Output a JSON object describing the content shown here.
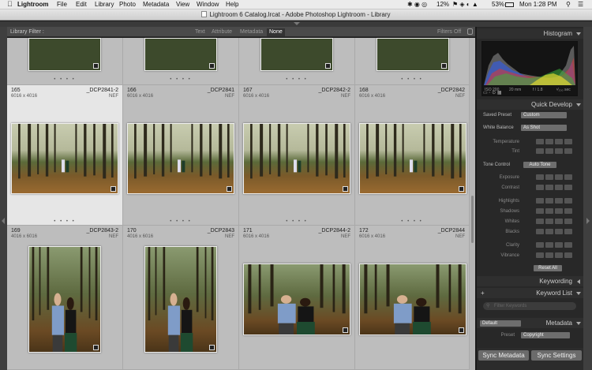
{
  "menubar": {
    "apple": "",
    "items": [
      "Lightroom",
      "File",
      "Edit",
      "Library",
      "Photo",
      "Metadata",
      "View",
      "Window",
      "Help"
    ],
    "status": {
      "pct_a": "12%",
      "battery": "53%",
      "clock": "Mon 1:28 PM"
    }
  },
  "window": {
    "title": "Lightroom 6 Catalog.lrcat - Adobe Photoshop Lightroom - Library"
  },
  "filterbar": {
    "label": "Library Filter :",
    "tabs": [
      "Text",
      "Attribute",
      "Metadata",
      "None"
    ],
    "active_tab": "None",
    "filters_off": "Filters Off"
  },
  "grid": {
    "dots": "• • • •",
    "cells": [
      {
        "num": "165",
        "dims": "6016 x 4016",
        "name": "_DCP2841-2",
        "type": "NEF",
        "selected": true
      },
      {
        "num": "166",
        "dims": "6016 x 4016",
        "name": "_DCP2841",
        "type": "NEF",
        "selected": false
      },
      {
        "num": "167",
        "dims": "6016 x 4016",
        "name": "_DCP2842-2",
        "type": "NEF",
        "selected": false
      },
      {
        "num": "168",
        "dims": "6016 x 4016",
        "name": "_DCP2842",
        "type": "NEF",
        "selected": false
      },
      {
        "num": "169",
        "dims": "4016 x 6016",
        "name": "_DCP2843-2",
        "type": "NEF",
        "selected": false
      },
      {
        "num": "170",
        "dims": "4016 x 6016",
        "name": "_DCP2843",
        "type": "NEF",
        "selected": false
      },
      {
        "num": "171",
        "dims": "6016 x 4016",
        "name": "_DCP2844-2",
        "type": "NEF",
        "selected": false
      },
      {
        "num": "172",
        "dims": "6016 x 4016",
        "name": "_DCP2844",
        "type": "NEF",
        "selected": false
      }
    ]
  },
  "histogram": {
    "title": "Histogram",
    "iso": "ISO 200",
    "focal": "20 mm",
    "aperture": "f / 1.8",
    "shutter": "¹⁄₂₀₀ sec"
  },
  "quick_develop": {
    "title": "Quick Develop",
    "saved_preset_label": "Saved Preset",
    "saved_preset_value": "Custom",
    "white_balance_label": "White Balance",
    "white_balance_value": "As Shot",
    "temperature": "Temperature",
    "tint": "Tint",
    "tone_control": "Tone Control",
    "auto_tone": "Auto Tone",
    "exposure": "Exposure",
    "contrast": "Contrast",
    "highlights": "Highlights",
    "shadows": "Shadows",
    "whites": "Whites",
    "blacks": "Blacks",
    "clarity": "Clarity",
    "vibrance": "Vibrance",
    "reset_all": "Reset All"
  },
  "keywording": {
    "title": "Keywording"
  },
  "keyword_list": {
    "title": "Keyword List",
    "filter_placeholder": "Filter Keywords"
  },
  "metadata": {
    "title": "Metadata",
    "preset_dropdown": "Default",
    "preset_label": "Preset",
    "preset_value": "Copyright"
  },
  "buttons": {
    "sync_metadata": "Sync Metadata",
    "sync_settings": "Sync Settings"
  }
}
